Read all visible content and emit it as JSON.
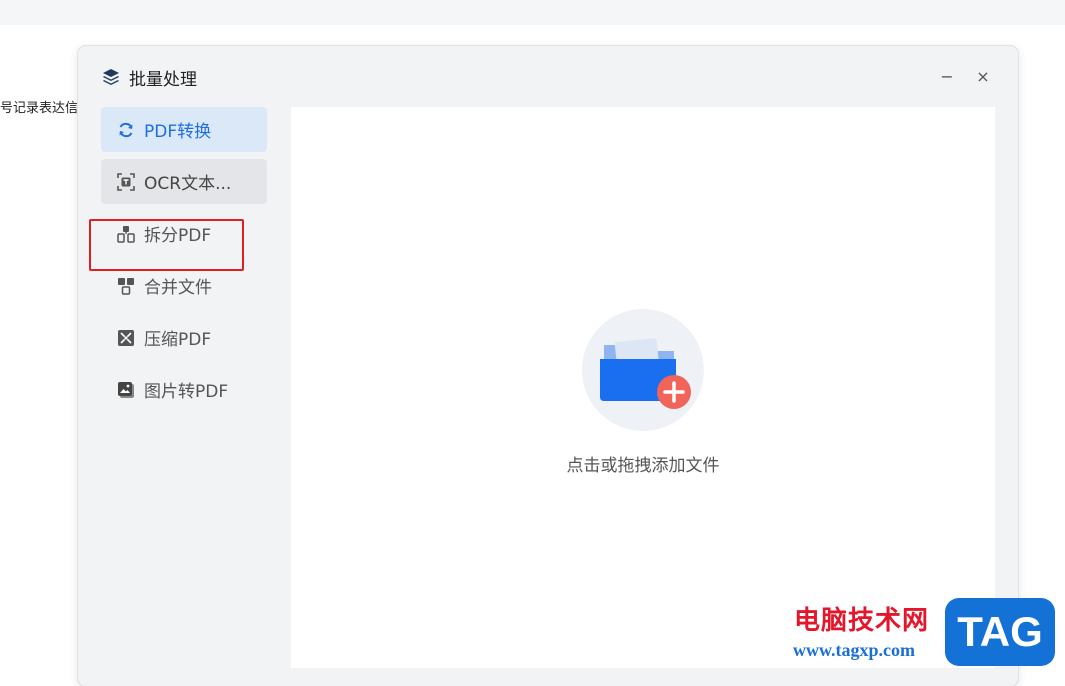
{
  "background": {
    "snippet_text": "号记录表达信"
  },
  "dialog": {
    "title": "批量处理",
    "minimize_glyph": "−",
    "close_glyph": "×"
  },
  "sidebar": {
    "items": [
      {
        "label": "PDF转换",
        "icon": "refresh-icon",
        "state": "selected"
      },
      {
        "label": "OCR文本...",
        "icon": "ocr-text-icon",
        "state": "hover"
      },
      {
        "label": "拆分PDF",
        "icon": "split-pdf-icon",
        "state": "highlighted"
      },
      {
        "label": "合并文件",
        "icon": "merge-files-icon",
        "state": "normal"
      },
      {
        "label": "压缩PDF",
        "icon": "compress-pdf-icon",
        "state": "normal"
      },
      {
        "label": "图片转PDF",
        "icon": "image-to-pdf-icon",
        "state": "normal"
      }
    ]
  },
  "main": {
    "dropzone_label": "点击或拖拽添加文件",
    "dropzone_icon": "folder-add-icon"
  },
  "watermark": {
    "site_name": "电脑技术网",
    "url": "www.tagxp.com",
    "badge": "TAG"
  },
  "colors": {
    "accent": "#1d6fe0",
    "selected_bg": "#dbe8f7",
    "highlight_border": "#e02020",
    "folder_blue": "#1a6ef0",
    "add_badge": "#f0645a"
  }
}
